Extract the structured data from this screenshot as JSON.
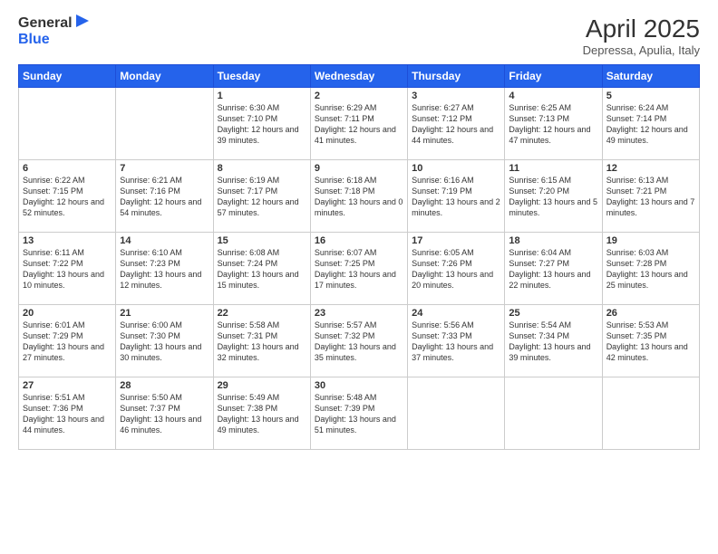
{
  "logo": {
    "general": "General",
    "blue": "Blue"
  },
  "title": "April 2025",
  "subtitle": "Depressa, Apulia, Italy",
  "days_of_week": [
    "Sunday",
    "Monday",
    "Tuesday",
    "Wednesday",
    "Thursday",
    "Friday",
    "Saturday"
  ],
  "weeks": [
    [
      {
        "day": "",
        "info": ""
      },
      {
        "day": "",
        "info": ""
      },
      {
        "day": "1",
        "info": "Sunrise: 6:30 AM\nSunset: 7:10 PM\nDaylight: 12 hours and 39 minutes."
      },
      {
        "day": "2",
        "info": "Sunrise: 6:29 AM\nSunset: 7:11 PM\nDaylight: 12 hours and 41 minutes."
      },
      {
        "day": "3",
        "info": "Sunrise: 6:27 AM\nSunset: 7:12 PM\nDaylight: 12 hours and 44 minutes."
      },
      {
        "day": "4",
        "info": "Sunrise: 6:25 AM\nSunset: 7:13 PM\nDaylight: 12 hours and 47 minutes."
      },
      {
        "day": "5",
        "info": "Sunrise: 6:24 AM\nSunset: 7:14 PM\nDaylight: 12 hours and 49 minutes."
      }
    ],
    [
      {
        "day": "6",
        "info": "Sunrise: 6:22 AM\nSunset: 7:15 PM\nDaylight: 12 hours and 52 minutes."
      },
      {
        "day": "7",
        "info": "Sunrise: 6:21 AM\nSunset: 7:16 PM\nDaylight: 12 hours and 54 minutes."
      },
      {
        "day": "8",
        "info": "Sunrise: 6:19 AM\nSunset: 7:17 PM\nDaylight: 12 hours and 57 minutes."
      },
      {
        "day": "9",
        "info": "Sunrise: 6:18 AM\nSunset: 7:18 PM\nDaylight: 13 hours and 0 minutes."
      },
      {
        "day": "10",
        "info": "Sunrise: 6:16 AM\nSunset: 7:19 PM\nDaylight: 13 hours and 2 minutes."
      },
      {
        "day": "11",
        "info": "Sunrise: 6:15 AM\nSunset: 7:20 PM\nDaylight: 13 hours and 5 minutes."
      },
      {
        "day": "12",
        "info": "Sunrise: 6:13 AM\nSunset: 7:21 PM\nDaylight: 13 hours and 7 minutes."
      }
    ],
    [
      {
        "day": "13",
        "info": "Sunrise: 6:11 AM\nSunset: 7:22 PM\nDaylight: 13 hours and 10 minutes."
      },
      {
        "day": "14",
        "info": "Sunrise: 6:10 AM\nSunset: 7:23 PM\nDaylight: 13 hours and 12 minutes."
      },
      {
        "day": "15",
        "info": "Sunrise: 6:08 AM\nSunset: 7:24 PM\nDaylight: 13 hours and 15 minutes."
      },
      {
        "day": "16",
        "info": "Sunrise: 6:07 AM\nSunset: 7:25 PM\nDaylight: 13 hours and 17 minutes."
      },
      {
        "day": "17",
        "info": "Sunrise: 6:05 AM\nSunset: 7:26 PM\nDaylight: 13 hours and 20 minutes."
      },
      {
        "day": "18",
        "info": "Sunrise: 6:04 AM\nSunset: 7:27 PM\nDaylight: 13 hours and 22 minutes."
      },
      {
        "day": "19",
        "info": "Sunrise: 6:03 AM\nSunset: 7:28 PM\nDaylight: 13 hours and 25 minutes."
      }
    ],
    [
      {
        "day": "20",
        "info": "Sunrise: 6:01 AM\nSunset: 7:29 PM\nDaylight: 13 hours and 27 minutes."
      },
      {
        "day": "21",
        "info": "Sunrise: 6:00 AM\nSunset: 7:30 PM\nDaylight: 13 hours and 30 minutes."
      },
      {
        "day": "22",
        "info": "Sunrise: 5:58 AM\nSunset: 7:31 PM\nDaylight: 13 hours and 32 minutes."
      },
      {
        "day": "23",
        "info": "Sunrise: 5:57 AM\nSunset: 7:32 PM\nDaylight: 13 hours and 35 minutes."
      },
      {
        "day": "24",
        "info": "Sunrise: 5:56 AM\nSunset: 7:33 PM\nDaylight: 13 hours and 37 minutes."
      },
      {
        "day": "25",
        "info": "Sunrise: 5:54 AM\nSunset: 7:34 PM\nDaylight: 13 hours and 39 minutes."
      },
      {
        "day": "26",
        "info": "Sunrise: 5:53 AM\nSunset: 7:35 PM\nDaylight: 13 hours and 42 minutes."
      }
    ],
    [
      {
        "day": "27",
        "info": "Sunrise: 5:51 AM\nSunset: 7:36 PM\nDaylight: 13 hours and 44 minutes."
      },
      {
        "day": "28",
        "info": "Sunrise: 5:50 AM\nSunset: 7:37 PM\nDaylight: 13 hours and 46 minutes."
      },
      {
        "day": "29",
        "info": "Sunrise: 5:49 AM\nSunset: 7:38 PM\nDaylight: 13 hours and 49 minutes."
      },
      {
        "day": "30",
        "info": "Sunrise: 5:48 AM\nSunset: 7:39 PM\nDaylight: 13 hours and 51 minutes."
      },
      {
        "day": "",
        "info": ""
      },
      {
        "day": "",
        "info": ""
      },
      {
        "day": "",
        "info": ""
      }
    ]
  ]
}
